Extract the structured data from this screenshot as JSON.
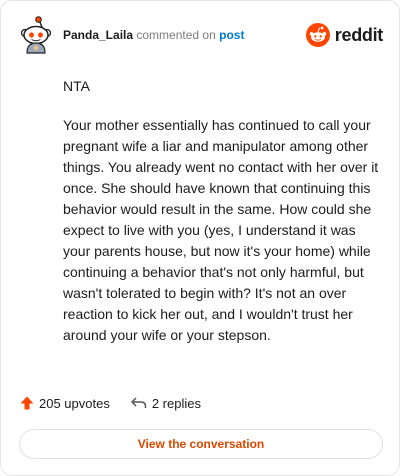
{
  "header": {
    "username": "Panda_Laila",
    "action": "commented on",
    "target": "post",
    "brand": "reddit"
  },
  "comment": {
    "paragraphs": [
      "NTA",
      "Your mother essentially has continued to call your pregnant wife a liar and manipulator among other things. You already went no contact with her over it once. She should have known that continuing this behavior would result in the same. How could she expect to live with you (yes, I understand it was your parents house, but now it's your home) while continuing a behavior that's not only harmful, but wasn't tolerated to begin with? It's not an over reaction to kick her out, and I wouldn't trust her around your wife or your stepson."
    ]
  },
  "stats": {
    "upvotes": "205 upvotes",
    "replies": "2 replies"
  },
  "cta": {
    "label": "View the conversation"
  },
  "colors": {
    "brand_orange": "#ff4500",
    "link_blue": "#0079d3",
    "cta_text": "#d94800"
  },
  "icons": {
    "avatar": "snoo-avatar",
    "logo": "reddit-logo-icon",
    "upvote": "upvote-arrow-icon",
    "reply": "reply-arrow-icon"
  }
}
